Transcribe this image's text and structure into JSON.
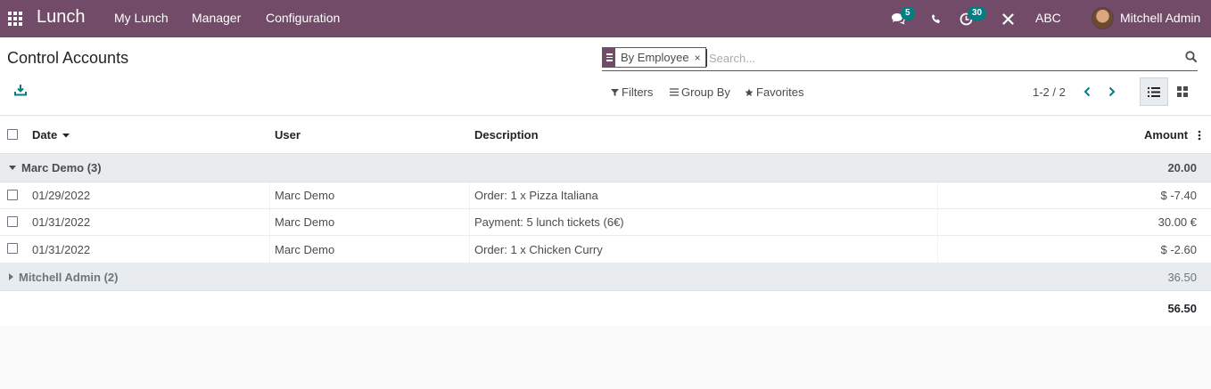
{
  "navbar": {
    "brand": "Lunch",
    "menu": [
      "My Lunch",
      "Manager",
      "Configuration"
    ],
    "messages_count": "5",
    "activities_count": "30",
    "company": "ABC",
    "user_name": "Mitchell Admin"
  },
  "control_panel": {
    "title": "Control Accounts",
    "facet_value": "By Employee",
    "facet_remove": "×",
    "search_placeholder": "Search...",
    "filters_label": "Filters",
    "group_by_label": "Group By",
    "favorites_label": "Favorites",
    "pager": "1-2 / 2"
  },
  "table": {
    "columns": {
      "date": "Date",
      "user": "User",
      "description": "Description",
      "amount": "Amount"
    },
    "groups": [
      {
        "label": "Marc Demo (3)",
        "total": "20.00",
        "expanded": true,
        "rows": [
          {
            "date": "01/29/2022",
            "user": "Marc Demo",
            "description": "Order: 1 x Pizza Italiana",
            "amount": "$ -7.40"
          },
          {
            "date": "01/31/2022",
            "user": "Marc Demo",
            "description": "Payment: 5 lunch tickets (6€)",
            "amount": "30.00 €"
          },
          {
            "date": "01/31/2022",
            "user": "Marc Demo",
            "description": "Order: 1 x Chicken Curry",
            "amount": "$ -2.60"
          }
        ]
      },
      {
        "label": "Mitchell Admin (2)",
        "total": "36.50",
        "expanded": false
      }
    ],
    "grand_total": "56.50"
  },
  "colors": {
    "brand": "#714b67",
    "accent": "#017e84"
  },
  "icons": [
    "apps-icon",
    "chat-icon",
    "phone-icon",
    "activity-icon",
    "tools-icon",
    "download-icon",
    "search-icon",
    "filter-icon",
    "group-icon",
    "star-icon",
    "chevron-left-icon",
    "chevron-right-icon",
    "list-view-icon",
    "kanban-view-icon",
    "column-options-icon"
  ]
}
